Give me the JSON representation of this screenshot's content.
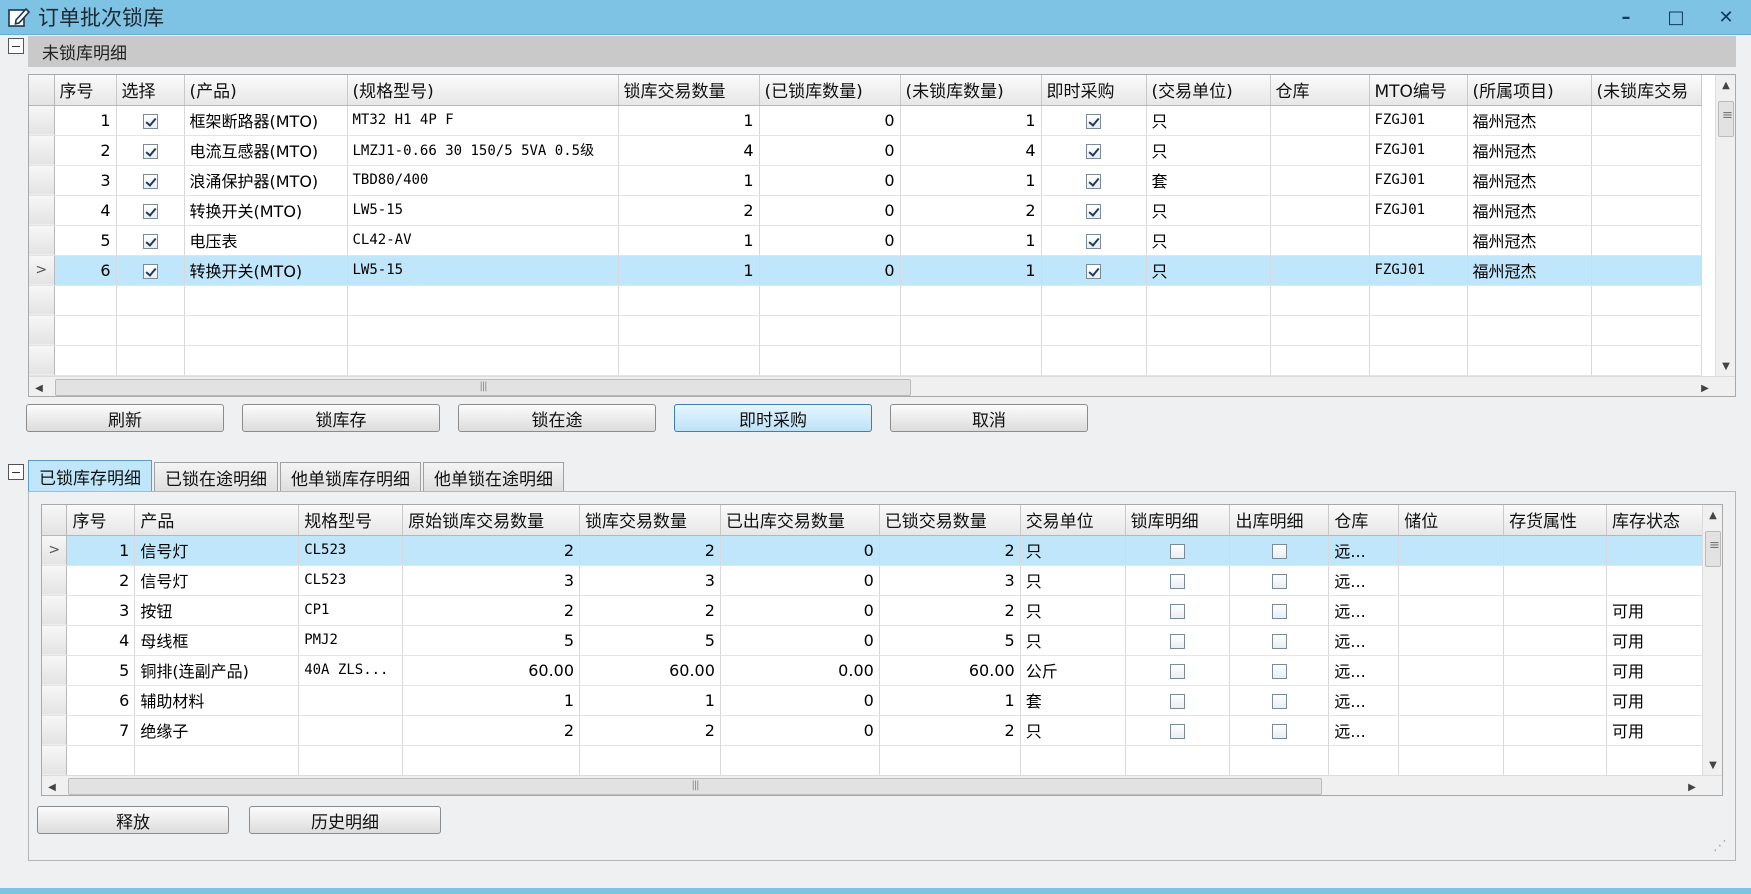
{
  "window": {
    "title": "订单批次锁库",
    "minimize": "–",
    "maximize": "□",
    "close": "✕"
  },
  "upper": {
    "section_title": "未锁库明细",
    "columns": [
      "序号",
      "选择",
      "(产品)",
      "(规格型号)",
      "锁库交易数量",
      "(已锁库数量)",
      "(未锁库数量)",
      "即时采购",
      "(交易单位)",
      "仓库",
      "MTO编号",
      "(所属项目)",
      "(未锁库交易"
    ],
    "rows": [
      {
        "seq": "1",
        "select": true,
        "product": "框架断路器(MTO)",
        "spec": "MT32 H1 4P F",
        "lock_qty": "1",
        "locked": "0",
        "unlocked": "1",
        "instant": true,
        "unit": "只",
        "warehouse": "",
        "mto": "FZGJ01",
        "project": "福州冠杰"
      },
      {
        "seq": "2",
        "select": true,
        "product": "电流互感器(MTO)",
        "spec": "LMZJ1-0.66 30 150/5 5VA 0.5级",
        "lock_qty": "4",
        "locked": "0",
        "unlocked": "4",
        "instant": true,
        "unit": "只",
        "warehouse": "",
        "mto": "FZGJ01",
        "project": "福州冠杰"
      },
      {
        "seq": "3",
        "select": true,
        "product": "浪涌保护器(MTO)",
        "spec": "TBD80/400",
        "lock_qty": "1",
        "locked": "0",
        "unlocked": "1",
        "instant": true,
        "unit": "套",
        "warehouse": "",
        "mto": "FZGJ01",
        "project": "福州冠杰"
      },
      {
        "seq": "4",
        "select": true,
        "product": "转换开关(MTO)",
        "spec": "LW5-15",
        "lock_qty": "2",
        "locked": "0",
        "unlocked": "2",
        "instant": true,
        "unit": "只",
        "warehouse": "",
        "mto": "FZGJ01",
        "project": "福州冠杰"
      },
      {
        "seq": "5",
        "select": true,
        "product": "电压表",
        "spec": "CL42-AV",
        "lock_qty": "1",
        "locked": "0",
        "unlocked": "1",
        "instant": true,
        "unit": "只",
        "warehouse": "",
        "mto": "",
        "project": "福州冠杰"
      },
      {
        "seq": "6",
        "select": true,
        "product": "转换开关(MTO)",
        "spec": "LW5-15",
        "lock_qty": "1",
        "locked": "0",
        "unlocked": "1",
        "instant": true,
        "unit": "只",
        "warehouse": "",
        "mto": "FZGJ01",
        "project": "福州冠杰",
        "selected": true
      }
    ],
    "empty_rows": 3,
    "buttons": {
      "refresh": "刷新",
      "lock_stock": "锁库存",
      "lock_transit": "锁在途",
      "instant_purchase": "即时采购",
      "cancel": "取消"
    }
  },
  "lower": {
    "tabs": [
      "已锁库存明细",
      "已锁在途明细",
      "他单锁库存明细",
      "他单锁在途明细"
    ],
    "active_tab": 0,
    "columns": [
      "序号",
      "产品",
      "规格型号",
      "原始锁库交易数量",
      "锁库交易数量",
      "已出库交易数量",
      "已锁交易数量",
      "交易单位",
      "锁库明细",
      "出库明细",
      "仓库",
      "储位",
      "存货属性",
      "库存状态"
    ],
    "rows": [
      {
        "seq": "1",
        "product": "信号灯",
        "spec": "CL523",
        "orig_qty": "2",
        "lock_qty": "2",
        "out_qty": "0",
        "locked_qty": "2",
        "unit": "只",
        "lock_detail": false,
        "out_detail": false,
        "warehouse": "远...",
        "bin": "",
        "attr": "",
        "status": "",
        "selected": true
      },
      {
        "seq": "2",
        "product": "信号灯",
        "spec": "CL523",
        "orig_qty": "3",
        "lock_qty": "3",
        "out_qty": "0",
        "locked_qty": "3",
        "unit": "只",
        "lock_detail": false,
        "out_detail": false,
        "warehouse": "远...",
        "bin": "",
        "attr": "",
        "status": ""
      },
      {
        "seq": "3",
        "product": "按钮",
        "spec": "CP1",
        "orig_qty": "2",
        "lock_qty": "2",
        "out_qty": "0",
        "locked_qty": "2",
        "unit": "只",
        "lock_detail": false,
        "out_detail": false,
        "warehouse": "远...",
        "bin": "",
        "attr": "",
        "status": "可用"
      },
      {
        "seq": "4",
        "product": "母线框",
        "spec": "PMJ2",
        "orig_qty": "5",
        "lock_qty": "5",
        "out_qty": "0",
        "locked_qty": "5",
        "unit": "只",
        "lock_detail": false,
        "out_detail": false,
        "warehouse": "远...",
        "bin": "",
        "attr": "",
        "status": "可用"
      },
      {
        "seq": "5",
        "product": "铜排(连副产品)",
        "spec": "40A ZLS...",
        "orig_qty": "60.00",
        "lock_qty": "60.00",
        "out_qty": "0.00",
        "locked_qty": "60.00",
        "unit": "公斤",
        "lock_detail": false,
        "out_detail": false,
        "warehouse": "远...",
        "bin": "",
        "attr": "",
        "status": "可用"
      },
      {
        "seq": "6",
        "product": "辅助材料",
        "spec": "",
        "orig_qty": "1",
        "lock_qty": "1",
        "out_qty": "0",
        "locked_qty": "1",
        "unit": "套",
        "lock_detail": false,
        "out_detail": false,
        "warehouse": "远...",
        "bin": "",
        "attr": "",
        "status": "可用"
      },
      {
        "seq": "7",
        "product": "绝缘子",
        "spec": "",
        "orig_qty": "2",
        "lock_qty": "2",
        "out_qty": "0",
        "locked_qty": "2",
        "unit": "只",
        "lock_detail": false,
        "out_detail": false,
        "warehouse": "远...",
        "bin": "",
        "attr": "",
        "status": "可用"
      }
    ],
    "buttons": {
      "release": "释放",
      "history": "历史明细"
    }
  },
  "colors": {
    "titlebar": "#7ec3e3",
    "selected_row": "#bfe6fb",
    "active_tab": "#bfe6fb"
  }
}
